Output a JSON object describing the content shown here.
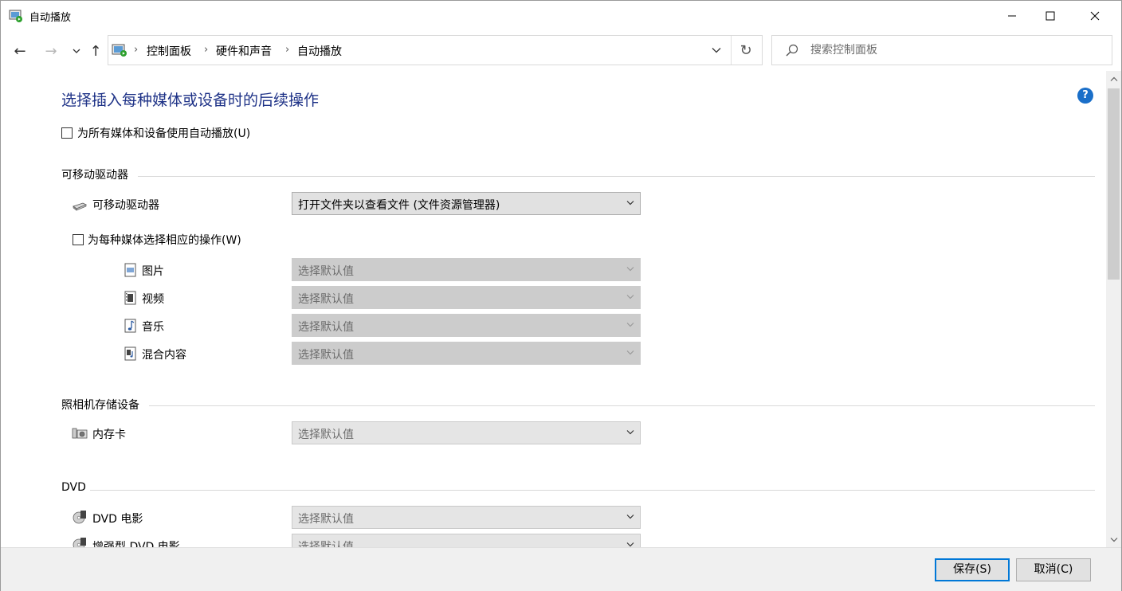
{
  "window": {
    "title": "自动播放",
    "minimize_glyph": "—",
    "maximize_glyph": "☐",
    "close_glyph": "✕"
  },
  "nav": {
    "back_glyph": "←",
    "forward_glyph": "→",
    "recent_glyph": "⌄",
    "up_glyph": "↑",
    "breadcrumbs": [
      "控制面板",
      "硬件和声音",
      "自动播放"
    ],
    "refresh_glyph": "↻",
    "search_placeholder": "搜索控制面板"
  },
  "main": {
    "title": "选择插入每种媒体或设备时的后续操作",
    "help_glyph": "?",
    "use_autoplay_all": {
      "label": "为所有媒体和设备使用自动播放(U)",
      "checked": false
    },
    "sections": {
      "removable": {
        "heading": "可移动驱动器",
        "device_label": "可移动驱动器",
        "device_value": "打开文件夹以查看文件 (文件资源管理器)",
        "per_media": {
          "label": "为每种媒体选择相应的操作(W)",
          "checked": false
        },
        "media": [
          {
            "label": "图片",
            "value": "选择默认值"
          },
          {
            "label": "视频",
            "value": "选择默认值"
          },
          {
            "label": "音乐",
            "value": "选择默认值"
          },
          {
            "label": "混合内容",
            "value": "选择默认值"
          }
        ]
      },
      "camera": {
        "heading": "照相机存储设备",
        "items": [
          {
            "label": "内存卡",
            "value": "选择默认值"
          }
        ]
      },
      "dvd": {
        "heading": "DVD",
        "items": [
          {
            "label": "DVD 电影",
            "value": "选择默认值"
          },
          {
            "label": "增强型 DVD 电影",
            "value": "选择默认值"
          }
        ]
      }
    }
  },
  "footer": {
    "save_label": "保存(S)",
    "cancel_label": "取消(C)"
  },
  "colors": {
    "title_blue": "#1e3287",
    "accent": "#0078d7",
    "help_blue": "#1a6fc9"
  },
  "icons": {
    "app": "autoplay-icon",
    "search": "search-icon",
    "help": "help-icon"
  }
}
